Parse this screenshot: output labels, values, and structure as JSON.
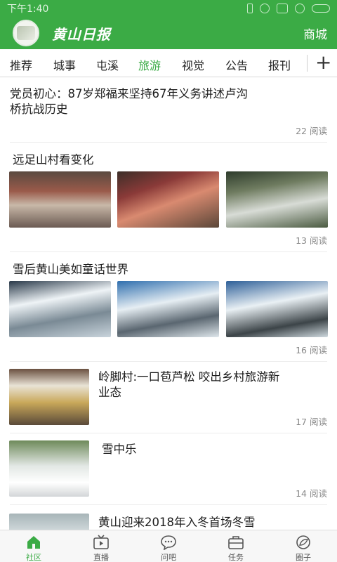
{
  "status_bar": {
    "time": "下午1:40",
    "icons": [
      "bluetooth-icon",
      "mute-icon",
      "sim-icon",
      "wifi-icon",
      "battery-icon"
    ]
  },
  "header": {
    "brand": "黄山日报",
    "mall_label": "商城"
  },
  "tabs": {
    "items": [
      {
        "label": "推荐"
      },
      {
        "label": "城事"
      },
      {
        "label": "屯溪"
      },
      {
        "label": "旅游"
      },
      {
        "label": "视觉"
      },
      {
        "label": "公告"
      },
      {
        "label": "报刊"
      }
    ],
    "active": "旅游",
    "add_symbol": "+"
  },
  "feed": {
    "articles": [
      {
        "title": "党员初心：87岁郑福来坚持67年义务讲述卢沟桥抗战历史",
        "reads": "22 阅读"
      },
      {
        "title": "远足山村看变化",
        "reads": "13 阅读"
      },
      {
        "title": "雪后黄山美如童话世界",
        "reads": "16 阅读"
      },
      {
        "title": "岭脚村:一口苞芦松 咬出乡村旅游新业态",
        "reads": "17 阅读"
      },
      {
        "title": "雪中乐",
        "reads": "14 阅读"
      },
      {
        "title": "黄山迎来2018年入冬首场冬雪"
      }
    ]
  },
  "bottom_nav": {
    "items": [
      {
        "label": "社区",
        "icon": "home-icon"
      },
      {
        "label": "直播",
        "icon": "tv-icon"
      },
      {
        "label": "问吧",
        "icon": "chat-bubble-icon"
      },
      {
        "label": "任务",
        "icon": "briefcase-icon"
      },
      {
        "label": "圈子",
        "icon": "circle-leaf-icon"
      }
    ],
    "active": "社区"
  },
  "colors": {
    "brand_green": "#3bab45",
    "tab_active": "#3bab45",
    "read_count_gray": "#888888"
  }
}
